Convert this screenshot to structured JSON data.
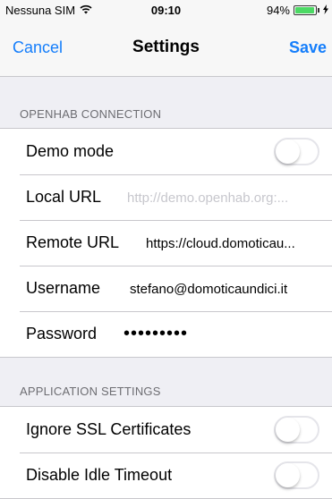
{
  "status_bar": {
    "carrier": "Nessuna SIM",
    "time": "09:10",
    "battery": "94%",
    "battery_level": 0.94
  },
  "nav": {
    "cancel_label": "Cancel",
    "title": "Settings",
    "save_label": "Save"
  },
  "openhab_connection": {
    "header": "OPENHAB CONNECTION",
    "demo_mode_label": "Demo mode",
    "demo_mode_on": false,
    "local_url_label": "Local URL",
    "local_url_placeholder": "http://demo.openhab.org:...",
    "remote_url_label": "Remote URL",
    "remote_url_value": "https://cloud.domoticau...",
    "username_label": "Username",
    "username_value": "stefano@domoticaundici.it",
    "password_label": "Password",
    "password_value": "•••••••••"
  },
  "application_settings": {
    "header": "APPLICATION SETTINGS",
    "ignore_ssl_label": "Ignore SSL Certificates",
    "ignore_ssl_on": false,
    "disable_idle_label": "Disable Idle Timeout",
    "disable_idle_on": false
  }
}
